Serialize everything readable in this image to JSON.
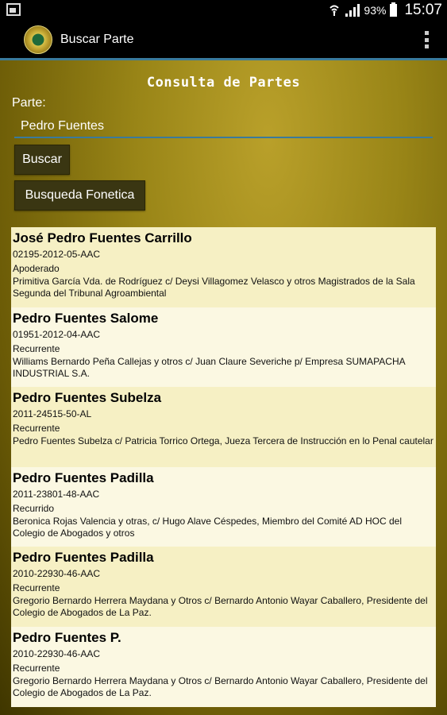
{
  "status_bar": {
    "battery": "93%",
    "time": "15:07"
  },
  "action_bar": {
    "title": "Buscar Parte",
    "logo_icon": "court-seal-logo",
    "menu_icon": "overflow-menu-icon"
  },
  "form": {
    "heading": "Consulta de Partes",
    "parte_label": "Parte:",
    "parte_value": "Pedro Fuentes",
    "buscar_label": "Buscar",
    "fonetica_label": "Busqueda Fonetica"
  },
  "colors": {
    "accent": "#3a7a9c",
    "row_odd": "#f6f0c4",
    "row_even": "#fbf8e2"
  },
  "results": [
    {
      "name": "José Pedro Fuentes Carrillo",
      "code": "02195-2012-05-AAC",
      "role": "Apoderado",
      "description": "Primitiva García Vda. de Rodríguez c/ Deysi Villagomez Velasco y otros Magistrados de la Sala Segunda del Tribunal Agroambiental"
    },
    {
      "name": "Pedro Fuentes Salome",
      "code": "01951-2012-04-AAC",
      "role": "Recurrente",
      "description": "Williams Bernardo Peña Callejas y otros c/ Juan Claure Severiche p/ Empresa SUMAPACHA INDUSTRIAL S.A."
    },
    {
      "name": "Pedro Fuentes Subelza",
      "code": "2011-24515-50-AL",
      "role": "Recurrente",
      "description": "Pedro Fuentes Subelza c/ Patricia Torrico Ortega, Jueza Tercera de Instrucción en lo Penal cautelar"
    },
    {
      "name": "Pedro Fuentes Padilla",
      "code": "2011-23801-48-AAC",
      "role": "Recurrido",
      "description": "Beronica Rojas Valencia y otras, c/ Hugo Alave Céspedes, Miembro del Comité AD HOC del Colegio de Abogados y otros"
    },
    {
      "name": "Pedro Fuentes Padilla",
      "code": "2010-22930-46-AAC",
      "role": "Recurrente",
      "description": "Gregorio Bernardo Herrera Maydana y Otros c/ Bernardo Antonio Wayar Caballero, Presidente del Colegio de Abogados de La Paz."
    },
    {
      "name": "Pedro Fuentes P.",
      "code": "2010-22930-46-AAC",
      "role": "Recurrente",
      "description": "Gregorio Bernardo Herrera Maydana y Otros c/ Bernardo Antonio Wayar Caballero, Presidente del Colegio de Abogados de La Paz."
    }
  ]
}
